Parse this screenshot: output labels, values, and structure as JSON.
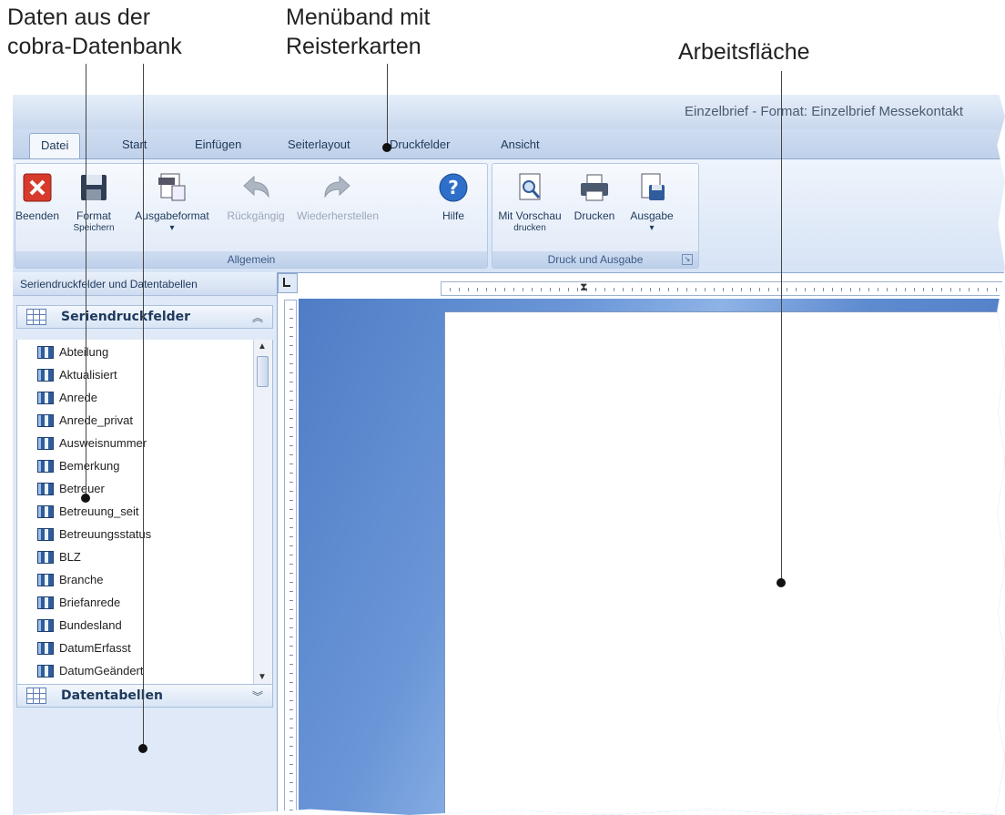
{
  "callouts": {
    "data_line1": "Daten aus der",
    "data_line2": "cobra-Datenbank",
    "ribbon_line1": "Menüband mit",
    "ribbon_line2": "Reisterkarten",
    "workspace": "Arbeitsfläche"
  },
  "window": {
    "title": "Einzelbrief - Format: Einzelbrief Messekontakt"
  },
  "tabs": [
    "Datei",
    "Start",
    "Einfügen",
    "Seiterlayout",
    "Druckfelder",
    "Ansicht"
  ],
  "ribbon": {
    "group_general": {
      "label": "Allgemein",
      "buttons": {
        "quit": "Beenden",
        "save_format_line1": "Format",
        "save_format_line2": "Speichern",
        "output_format": "Ausgabeformat",
        "undo": "Rückgängig",
        "redo": "Wiederherstellen",
        "help": "Hilfe"
      }
    },
    "group_print": {
      "label": "Druck und Ausgabe",
      "buttons": {
        "preview_line1": "Mit Vorschau",
        "preview_line2": "drucken",
        "print": "Drucken",
        "output": "Ausgabe"
      }
    }
  },
  "panel": {
    "header": "Seriendruckfelder und Datentabellen",
    "fields_section": "Seriendruckfelder",
    "tables_section": "Datentabellen",
    "fields": [
      "Abteilung",
      "Aktualisiert",
      "Anrede",
      "Anrede_privat",
      "Ausweisnummer",
      "Bemerkung",
      "Betreuer",
      "Betreuung_seit",
      "Betreuungsstatus",
      "BLZ",
      "Branche",
      "Briefanrede",
      "Bundesland",
      "DatumErfasst",
      "DatumGeändert"
    ]
  },
  "colors": {
    "ribbon": "#dfe9f7",
    "workspace": "#5f8bd0",
    "accent": "#1e395b"
  },
  "icons": [
    "close-red-icon",
    "floppy-disk-icon",
    "document-format-icon",
    "undo-arrow-icon",
    "redo-arrow-icon",
    "help-question-icon",
    "print-preview-icon",
    "printer-icon",
    "save-output-icon",
    "field-icon",
    "table-grid-icon"
  ]
}
